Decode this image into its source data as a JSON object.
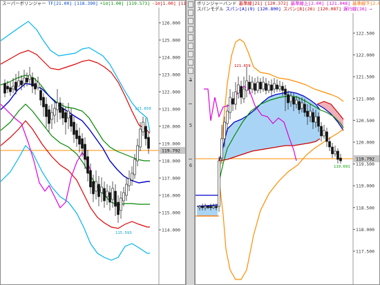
{
  "left_chart": {
    "title_line": [
      {
        "text": "スーパーボリンジャー",
        "color": "#222222"
      },
      {
        "text": "TF[21.00]",
        "color": "#0044cc"
      },
      {
        "text": "[118.390]",
        "color": "#0044cc"
      },
      {
        "text": "+1σ[1.00]",
        "color": "#008800"
      },
      {
        "text": "[119.573]",
        "color": "#008800"
      },
      {
        "text": "-1σ[1.00]",
        "color": "#cc0000"
      },
      {
        "text": "[117.206]",
        "color": "#cc0000"
      },
      {
        "text": "+2σ[2.00]",
        "color": "#cc0000"
      },
      {
        "text": "[120.758]",
        "color": "#cc0000"
      },
      {
        "text": "-2σ[2.0",
        "color": "#cc00cc"
      }
    ],
    "price_labels": [
      "126.000",
      "125.000",
      "124.000",
      "123.000",
      "122.000",
      "121.000",
      "120.000",
      "119.000",
      "118.000",
      "117.000",
      "116.000",
      "115.000",
      "114.000"
    ],
    "current_price": "119.792",
    "annotation_high": "121.659",
    "annotation_low": "115.593"
  },
  "right_chart": {
    "title_lines": [
      [
        {
          "text": "ボリンジャーバンド",
          "color": "#222222"
        },
        {
          "text": "基準線[21]",
          "color": "#cc0000"
        },
        {
          "text": "[120.372]",
          "color": "#cc0000"
        },
        {
          "text": "基準線上[2.00]",
          "color": "#cc00cc"
        },
        {
          "text": "[121.048]",
          "color": "#cc00cc"
        },
        {
          "text": "基準線下[2.00]",
          "color": "#ff6600"
        },
        {
          "text": "[118.890]",
          "color": "#ff6600"
        }
      ],
      [
        {
          "text": "スパンモデル",
          "color": "#222222"
        },
        {
          "text": "スパン[A](9)",
          "color": "#0000cc"
        },
        {
          "text": "[120.800]",
          "color": "#0000cc"
        },
        {
          "text": "スパン[B](26)",
          "color": "#cc0000"
        },
        {
          "text": "[120.087]",
          "color": "#cc0000"
        },
        {
          "text": "遅行線[26]",
          "color": "#cc00cc"
        },
        {
          "text": "→",
          "color": "#cc00cc"
        }
      ]
    ],
    "price_labels": [
      "122.500",
      "122.000",
      "121.500",
      "121.000",
      "120.500",
      "120.000",
      "119.500",
      "119.000",
      "118.500",
      "118.000",
      "117.500"
    ],
    "current_price": "119.792",
    "annotation_high": "121.659",
    "annotation_low": "119.691"
  },
  "scrollbar": {
    "label_top": "1",
    "label_mid": "5",
    "label_low": "6"
  },
  "colors": {
    "upper2": "#00b4f0",
    "upper1": "#dd0000",
    "mid_green": "#008800",
    "center_blue": "#0000cc",
    "lagging": "#dd00dd",
    "price_line": "#ff8c00",
    "kumo_blue": "#aad4f5",
    "kumo_red": "#f0b0b8"
  }
}
